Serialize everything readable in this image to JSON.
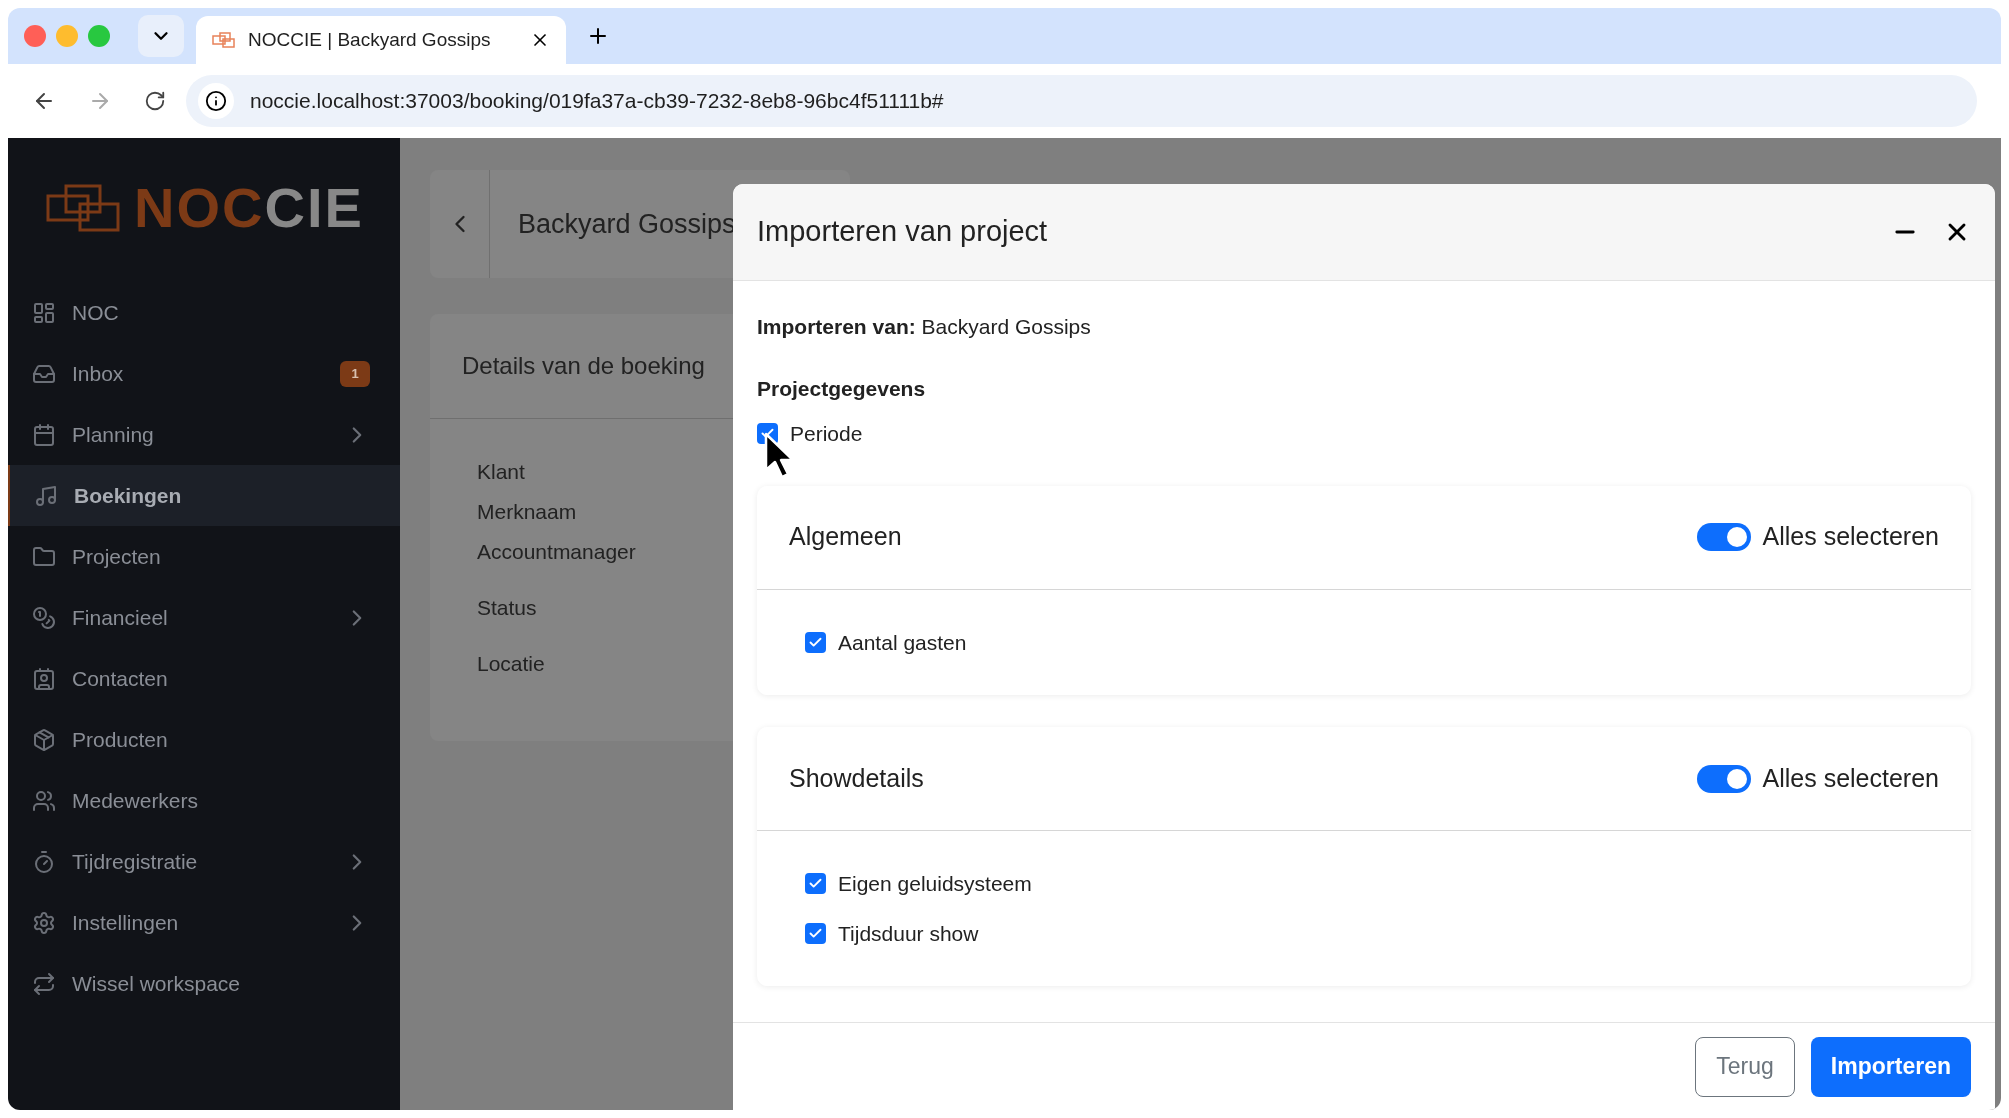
{
  "browser": {
    "tab_title": "NOCCIE | Backyard Gossips",
    "url": "noccie.localhost:37003/booking/019fa37a-cb39-7232-8eb8-96bc4f51111b#"
  },
  "sidebar": {
    "logo": {
      "part_1": "NOC",
      "part_2": "CIE"
    },
    "items": [
      {
        "label": "NOC",
        "selected": false,
        "has_children": false
      },
      {
        "label": "Inbox",
        "selected": false,
        "has_children": false,
        "badge": "1"
      },
      {
        "label": "Planning",
        "selected": false,
        "has_children": true
      },
      {
        "label": "Boekingen",
        "selected": true,
        "has_children": false
      },
      {
        "label": "Projecten",
        "selected": false,
        "has_children": false
      },
      {
        "label": "Financieel",
        "selected": false,
        "has_children": true
      },
      {
        "label": "Contacten",
        "selected": false,
        "has_children": false
      },
      {
        "label": "Producten",
        "selected": false,
        "has_children": false
      },
      {
        "label": "Medewerkers",
        "selected": false,
        "has_children": false
      },
      {
        "label": "Tijdregistratie",
        "selected": false,
        "has_children": true
      },
      {
        "label": "Instellingen",
        "selected": false,
        "has_children": true
      },
      {
        "label": "Wissel workspace",
        "selected": false,
        "has_children": false
      }
    ]
  },
  "page": {
    "title": "Backyard Gossips",
    "details_title": "Details van de boeking",
    "field_groups": [
      [
        "Klant",
        "Merknaam",
        "Accountmanager"
      ],
      [
        "Status"
      ],
      [
        "Locatie"
      ]
    ]
  },
  "dialog": {
    "title": "Importeren van project",
    "source": "**Importeren van:** Backyard Gossips",
    "project_title": "Projectgegevens",
    "project_items": [
      {
        "label": "Periode",
        "checked": true
      }
    ],
    "groups": [
      {
        "title": "Algemeen",
        "toggle_label": "Alles selecteren",
        "on": true,
        "items": [
          {
            "label": "Aantal gasten",
            "checked": true
          }
        ]
      },
      {
        "title": "Showdetails",
        "toggle_label": "Alles selecteren",
        "on": true,
        "items": [
          {
            "label": "Eigen geluidsysteem",
            "checked": true
          },
          {
            "label": "Tijdsduur show",
            "checked": true
          }
        ]
      }
    ],
    "buttons": [
      {
        "label": "Terug",
        "kind": "secondary"
      },
      {
        "label": "Importeren",
        "kind": "primary"
      }
    ]
  }
}
